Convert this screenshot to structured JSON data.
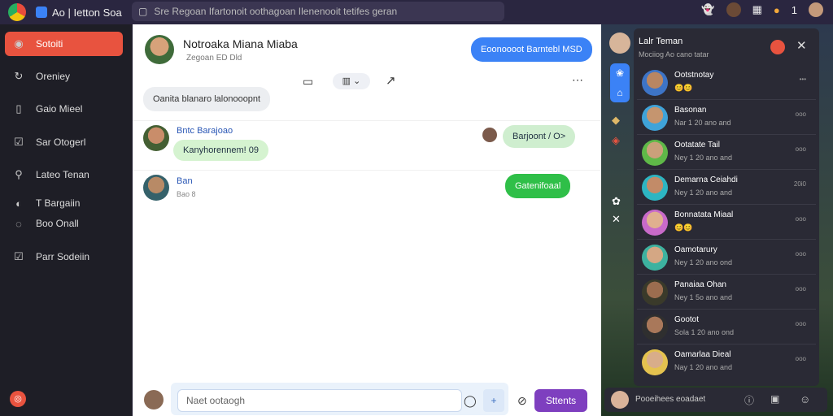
{
  "app": {
    "title": "Ao | Ietton Soa"
  },
  "search": {
    "placeholder": "Sre Regoan Ifartonoit oothagoan Ilenenooit tetifes geran"
  },
  "topbar": {
    "badge": "1"
  },
  "sidebar": {
    "items": [
      {
        "label": "Sotoiti",
        "icon": "chat-icon",
        "active": true
      },
      {
        "label": "Oreniey",
        "icon": "refresh-icon"
      },
      {
        "label": "Gaio Mieel",
        "icon": "bookmark-icon"
      },
      {
        "label": "Sar Otogerl",
        "icon": "check-icon"
      },
      {
        "label": "Lateo Tenan",
        "icon": "pin-icon"
      },
      {
        "label": "T Bargaiin",
        "icon": "flame-icon"
      },
      {
        "label": "Boo Onall",
        "icon": "globe-icon"
      },
      {
        "label": "Parr Sodeiin",
        "icon": "check-icon"
      }
    ]
  },
  "chat": {
    "contact_name": "Notroaka Miana Miaba",
    "contact_status": "Zegoan  ED  Dld",
    "header_bubble": "Eoonoooot Barntebl MSD",
    "pinned_note": "Oanita blanaro lalonooopnt",
    "messages": [
      {
        "author": "Bntc Barajoao",
        "text": "Kanyhorennem! 09",
        "reply": "Barjoont  /  O>"
      },
      {
        "author": "Ban",
        "sub": "Bao 8",
        "reply": "Gatenifoaal"
      }
    ],
    "input_placeholder": "Naet ootaogh",
    "send_label": "Sttents"
  },
  "panel": {
    "title": "Lalr Teman",
    "subtitle": "Mociiog Ao cano tatar",
    "contacts": [
      {
        "name": "Ootstnotay",
        "sub": "",
        "time": "•••"
      },
      {
        "name": "Basonan",
        "sub": "Nar 1 20 ano and",
        "time": "ooo"
      },
      {
        "name": "Ootatate Tail",
        "sub": "Ney 1 20 ano and",
        "time": "ooo"
      },
      {
        "name": "Demarna Ceiahdi",
        "sub": "Ney 1 20 ano and",
        "time": "20i0"
      },
      {
        "name": "Bonnatata Miaal",
        "sub": "",
        "time": "ooo"
      },
      {
        "name": "Oamotarury",
        "sub": "Ney 1 20 ano ond",
        "time": "ooo"
      },
      {
        "name": "Panaiaa Ohan",
        "sub": "Ney 1 5o ano and",
        "time": "ooo"
      },
      {
        "name": "Gootot",
        "sub": "Sola 1 20 ano ond",
        "time": "ooo"
      },
      {
        "name": "Oamarlaa Dieal",
        "sub": "Nay 1 20 ano and",
        "time": "ooo"
      }
    ],
    "footer_text": "Pooeihees eoadaet"
  },
  "colors": {
    "accent": "#e8533f",
    "send": "#7e3fbf",
    "blue": "#3b82f6",
    "green": "#2fbf48"
  }
}
